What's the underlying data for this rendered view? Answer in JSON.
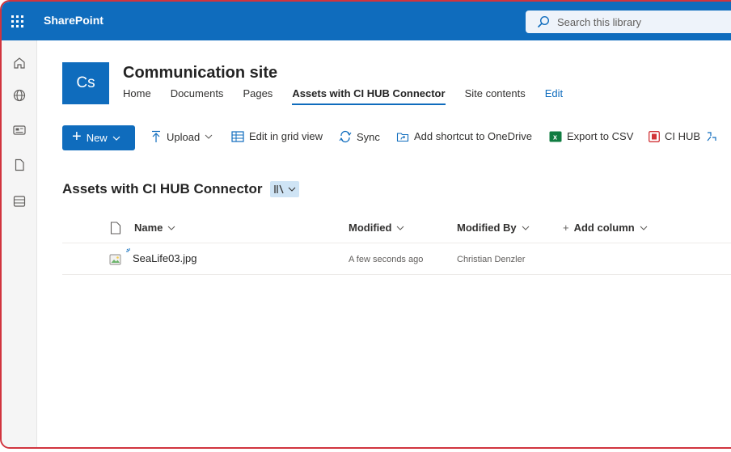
{
  "suite": {
    "brand": "SharePoint",
    "search_placeholder": "Search this library"
  },
  "app_bar": {
    "icons": [
      "home-icon",
      "globe-icon",
      "news-icon",
      "file-icon",
      "list-icon"
    ]
  },
  "site": {
    "logo_text": "Cs",
    "title": "Communication site",
    "nav": [
      "Home",
      "Documents",
      "Pages",
      "Assets with CI HUB Connector",
      "Site contents",
      "Edit"
    ],
    "active_nav": "Assets with CI HUB Connector"
  },
  "command_bar": {
    "new_label": "New",
    "upload_label": "Upload",
    "grid_label": "Edit in grid view",
    "sync_label": "Sync",
    "shortcut_label": "Add shortcut to OneDrive",
    "export_label": "Export to CSV",
    "cihub_label": "CI HUB"
  },
  "library": {
    "title": "Assets with CI HUB Connector",
    "columns": {
      "name": "Name",
      "modified": "Modified",
      "modified_by": "Modified By",
      "add_column": "Add column"
    },
    "rows": [
      {
        "name": "SeaLife03.jpg",
        "modified": "A few seconds ago",
        "modified_by": "Christian Denzler"
      }
    ]
  },
  "colors": {
    "brand_blue": "#0f6cbd",
    "frame_border": "#d1343e",
    "excel_green": "#107c41",
    "cihub_red": "#d13438"
  }
}
